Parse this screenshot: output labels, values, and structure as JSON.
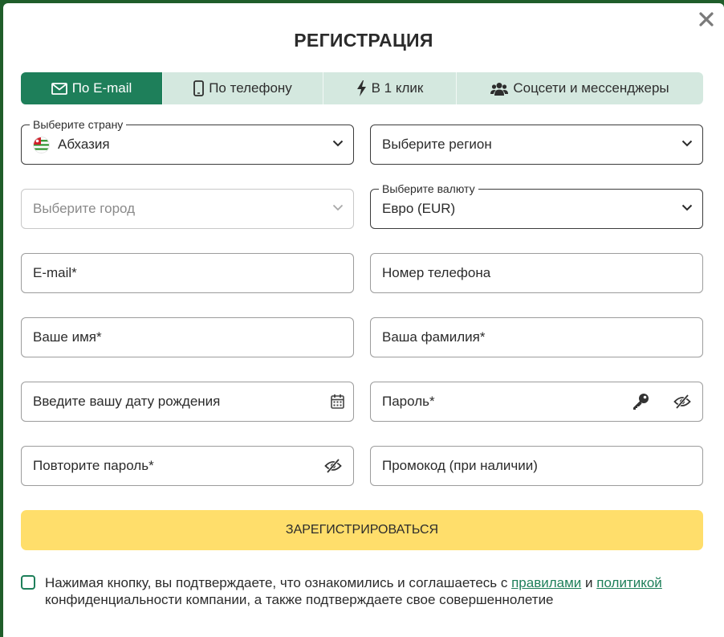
{
  "modal": {
    "title": "РЕГИСТРАЦИЯ",
    "close_icon": "close-icon"
  },
  "tabs": [
    {
      "label": "По E-mail",
      "icon": "envelope-icon",
      "active": true
    },
    {
      "label": "По телефону",
      "icon": "mobile-phone-icon",
      "active": false
    },
    {
      "label": "В 1 клик",
      "icon": "lightning-icon",
      "active": false
    },
    {
      "label": "Соцсети и мессенджеры",
      "icon": "users-icon",
      "active": false
    }
  ],
  "form": {
    "country": {
      "legend": "Выберите страну",
      "value": "Абхазия",
      "icon": "flag-icon"
    },
    "region": {
      "placeholder": "Выберите регион"
    },
    "city": {
      "placeholder": "Выберите город"
    },
    "currency": {
      "legend": "Выберите валюту",
      "value": "Евро (EUR)"
    },
    "email": {
      "placeholder": "E-mail*"
    },
    "phone": {
      "placeholder": "Номер телефона"
    },
    "first_name": {
      "placeholder": "Ваше имя*"
    },
    "last_name": {
      "placeholder": "Ваша фамилия*"
    },
    "birthdate": {
      "placeholder": "Введите вашу дату рождения",
      "icon": "calendar-icon"
    },
    "password": {
      "placeholder": "Пароль*",
      "icons": [
        "key-icon",
        "eye-slash-icon"
      ]
    },
    "repeat_password": {
      "placeholder": "Повторите пароль*",
      "icon": "eye-slash-icon"
    },
    "promo": {
      "placeholder": "Промокод (при наличии)"
    }
  },
  "submit": {
    "label": "ЗАРЕГИСТРИРОВАТЬСЯ"
  },
  "consent": {
    "text_1": "Нажимая кнопку, вы подтверждаете, что ознакомились и соглашаетесь с ",
    "rules_link": "правилами",
    "and": " и ",
    "policy_link": "политикой",
    "text_2": " конфиденциальности компании, а также подтверждаете свое совершеннолетие"
  },
  "colors": {
    "accent": "#1e7f5a",
    "tab_bg": "#d4e8df",
    "submit_bg": "#ffde6b",
    "backdrop": "#1f5d2a"
  }
}
